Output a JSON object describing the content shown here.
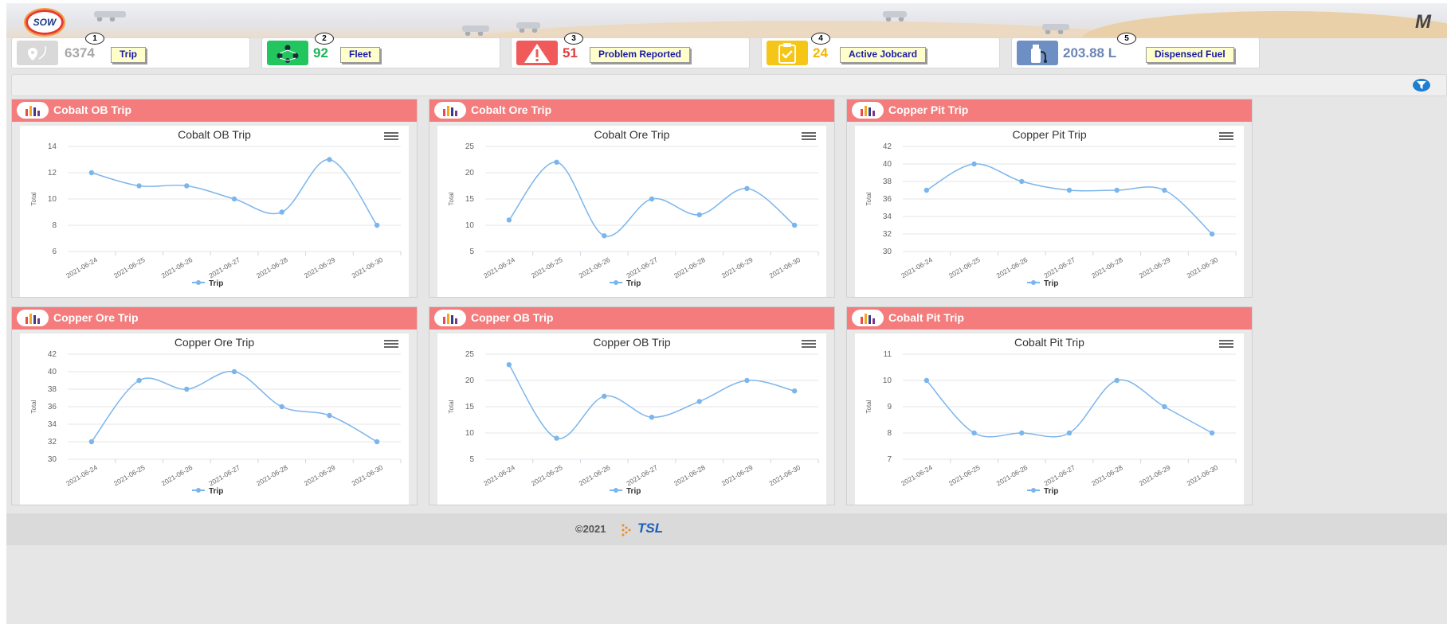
{
  "header": {
    "logo_text": "SOW",
    "brand_mark": "M"
  },
  "stats": [
    {
      "badge": "1",
      "value": "6374",
      "label": "Trip",
      "icon": "map-pin-icon",
      "icon_bg": "#d9d9d9",
      "value_color": "#a8a8a8"
    },
    {
      "badge": "2",
      "value": "92",
      "label": "Fleet",
      "icon": "fleet-network-icon",
      "icon_bg": "#22c55e",
      "value_color": "#1fb356"
    },
    {
      "badge": "3",
      "value": "51",
      "label": "Problem Reported",
      "icon": "warning-icon",
      "icon_bg": "#f05a5a",
      "value_color": "#e03c3c"
    },
    {
      "badge": "4",
      "value": "24",
      "label": "Active Jobcard",
      "icon": "clipboard-check-icon",
      "icon_bg": "#f5c518",
      "value_color": "#f2b707"
    },
    {
      "badge": "5",
      "value": "203.88 L",
      "label": "Dispensed Fuel",
      "icon": "fuel-icon",
      "icon_bg": "#6d8fc4",
      "value_color": "#6a86b5"
    }
  ],
  "filter": {
    "icon": "filter-icon"
  },
  "panels": [
    {
      "title": "Cobalt OB Trip"
    },
    {
      "title": "Cobalt Ore Trip"
    },
    {
      "title": "Copper Pit Trip"
    },
    {
      "title": "Copper Ore Trip"
    },
    {
      "title": "Copper OB Trip"
    },
    {
      "title": "Cobalt Pit Trip"
    }
  ],
  "chart_data": [
    {
      "type": "line",
      "title": "Cobalt OB Trip",
      "ylabel": "Total",
      "ylim": [
        6,
        14
      ],
      "yticks": [
        6,
        8,
        10,
        12,
        14
      ],
      "categories": [
        "2021-06-24",
        "2021-06-25",
        "2021-06-26",
        "2021-06-27",
        "2021-06-28",
        "2021-06-29",
        "2021-06-30"
      ],
      "series": [
        {
          "name": "Trip",
          "values": [
            12,
            11,
            11,
            10,
            9,
            13,
            8
          ]
        }
      ],
      "legend": "bottom",
      "grid": true
    },
    {
      "type": "line",
      "title": "Cobalt Ore Trip",
      "ylabel": "Total",
      "ylim": [
        5,
        25
      ],
      "yticks": [
        5,
        10,
        15,
        20,
        25
      ],
      "categories": [
        "2021-06-24",
        "2021-06-25",
        "2021-06-26",
        "2021-06-27",
        "2021-06-28",
        "2021-06-29",
        "2021-06-30"
      ],
      "series": [
        {
          "name": "Trip",
          "values": [
            11,
            22,
            8,
            15,
            12,
            17,
            10
          ]
        }
      ],
      "legend": "bottom",
      "grid": true
    },
    {
      "type": "line",
      "title": "Copper Pit Trip",
      "ylabel": "Total",
      "ylim": [
        30,
        42
      ],
      "yticks": [
        30,
        32,
        34,
        36,
        38,
        40,
        42
      ],
      "categories": [
        "2021-06-24",
        "2021-06-25",
        "2021-06-26",
        "2021-06-27",
        "2021-06-28",
        "2021-06-29",
        "2021-06-30"
      ],
      "series": [
        {
          "name": "Trip",
          "values": [
            37,
            40,
            38,
            37,
            37,
            37,
            32
          ]
        }
      ],
      "legend": "bottom",
      "grid": true
    },
    {
      "type": "line",
      "title": "Copper Ore Trip",
      "ylabel": "Total",
      "ylim": [
        30,
        42
      ],
      "yticks": [
        30,
        32,
        34,
        36,
        38,
        40,
        42
      ],
      "categories": [
        "2021-06-24",
        "2021-06-25",
        "2021-06-26",
        "2021-06-27",
        "2021-06-28",
        "2021-06-29",
        "2021-06-30"
      ],
      "series": [
        {
          "name": "Trip",
          "values": [
            32,
            39,
            38,
            40,
            36,
            35,
            32
          ]
        }
      ],
      "legend": "bottom",
      "grid": true
    },
    {
      "type": "line",
      "title": "Copper OB Trip",
      "ylabel": "Total",
      "ylim": [
        5,
        25
      ],
      "yticks": [
        5,
        10,
        15,
        20,
        25
      ],
      "categories": [
        "2021-06-24",
        "2021-06-25",
        "2021-06-26",
        "2021-06-27",
        "2021-06-28",
        "2021-06-29",
        "2021-06-30"
      ],
      "series": [
        {
          "name": "Trip",
          "values": [
            23,
            9,
            17,
            13,
            16,
            20,
            18
          ]
        }
      ],
      "legend": "bottom",
      "grid": true
    },
    {
      "type": "line",
      "title": "Cobalt Pit Trip",
      "ylabel": "Total",
      "ylim": [
        7,
        11
      ],
      "yticks": [
        7,
        8,
        9,
        10,
        11
      ],
      "categories": [
        "2021-06-24",
        "2021-06-25",
        "2021-06-26",
        "2021-06-27",
        "2021-06-28",
        "2021-06-29",
        "2021-06-30"
      ],
      "series": [
        {
          "name": "Trip",
          "values": [
            10,
            8,
            8,
            8,
            10,
            9,
            8
          ]
        }
      ],
      "legend": "bottom",
      "grid": true
    }
  ],
  "colors": {
    "series": "#7cb5ec",
    "panel_header": "#f47c7c"
  },
  "footer": {
    "copyright": "©2021",
    "company_logo": "TSL"
  }
}
